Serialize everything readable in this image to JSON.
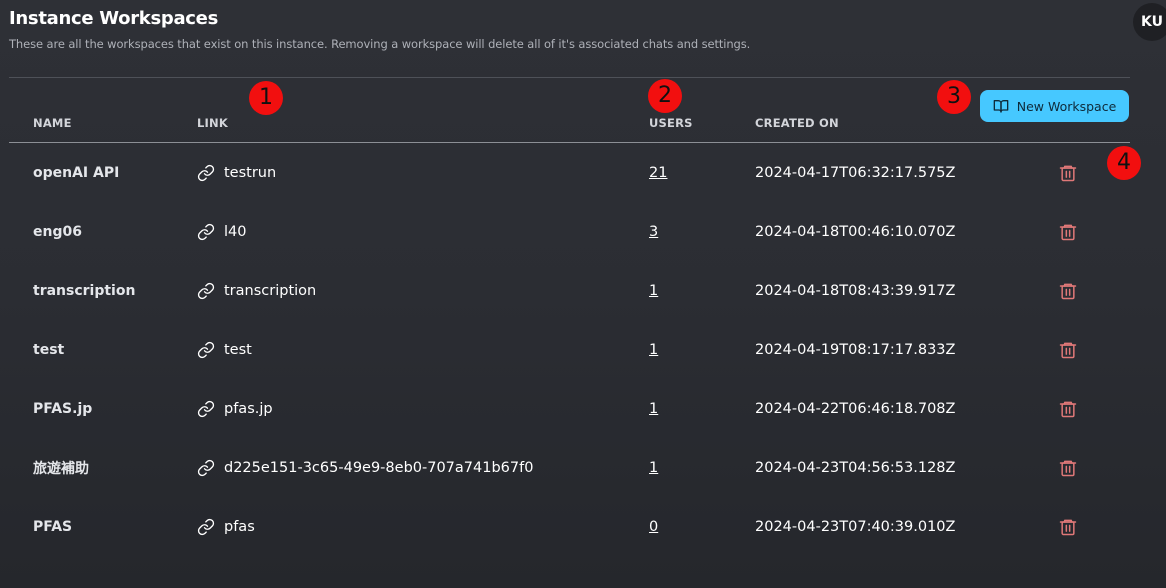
{
  "header": {
    "title": "Instance Workspaces",
    "subtitle": "These are all the workspaces that exist on this instance. Removing a workspace will delete all of it's associated chats and settings."
  },
  "user": {
    "initials": "KU"
  },
  "new_workspace_button": {
    "label": "New Workspace",
    "icon": "book-open-icon",
    "color": "#46c8ff"
  },
  "table": {
    "columns": [
      "NAME",
      "LINK",
      "USERS",
      "CREATED ON"
    ],
    "rows": [
      {
        "name": "openAI API",
        "link": "testrun",
        "users": "21",
        "created": "2024-04-17T06:32:17.575Z"
      },
      {
        "name": "eng06",
        "link": "l40",
        "users": "3",
        "created": "2024-04-18T00:46:10.070Z"
      },
      {
        "name": "transcription",
        "link": "transcription",
        "users": "1",
        "created": "2024-04-18T08:43:39.917Z"
      },
      {
        "name": "test",
        "link": "test",
        "users": "1",
        "created": "2024-04-19T08:17:17.833Z"
      },
      {
        "name": "PFAS.jp",
        "link": "pfas.jp",
        "users": "1",
        "created": "2024-04-22T06:46:18.708Z"
      },
      {
        "name": "旅遊補助",
        "link": "d225e151-3c65-49e9-8eb0-707a741b67f0",
        "users": "1",
        "created": "2024-04-23T04:56:53.128Z"
      },
      {
        "name": "PFAS",
        "link": "pfas",
        "users": "0",
        "created": "2024-04-23T07:40:39.010Z"
      }
    ]
  },
  "markers": [
    "1",
    "2",
    "3",
    "4"
  ],
  "colors": {
    "background": "#2b2d33",
    "delete_icon": "#e07878",
    "marker": "#f20f0f"
  }
}
